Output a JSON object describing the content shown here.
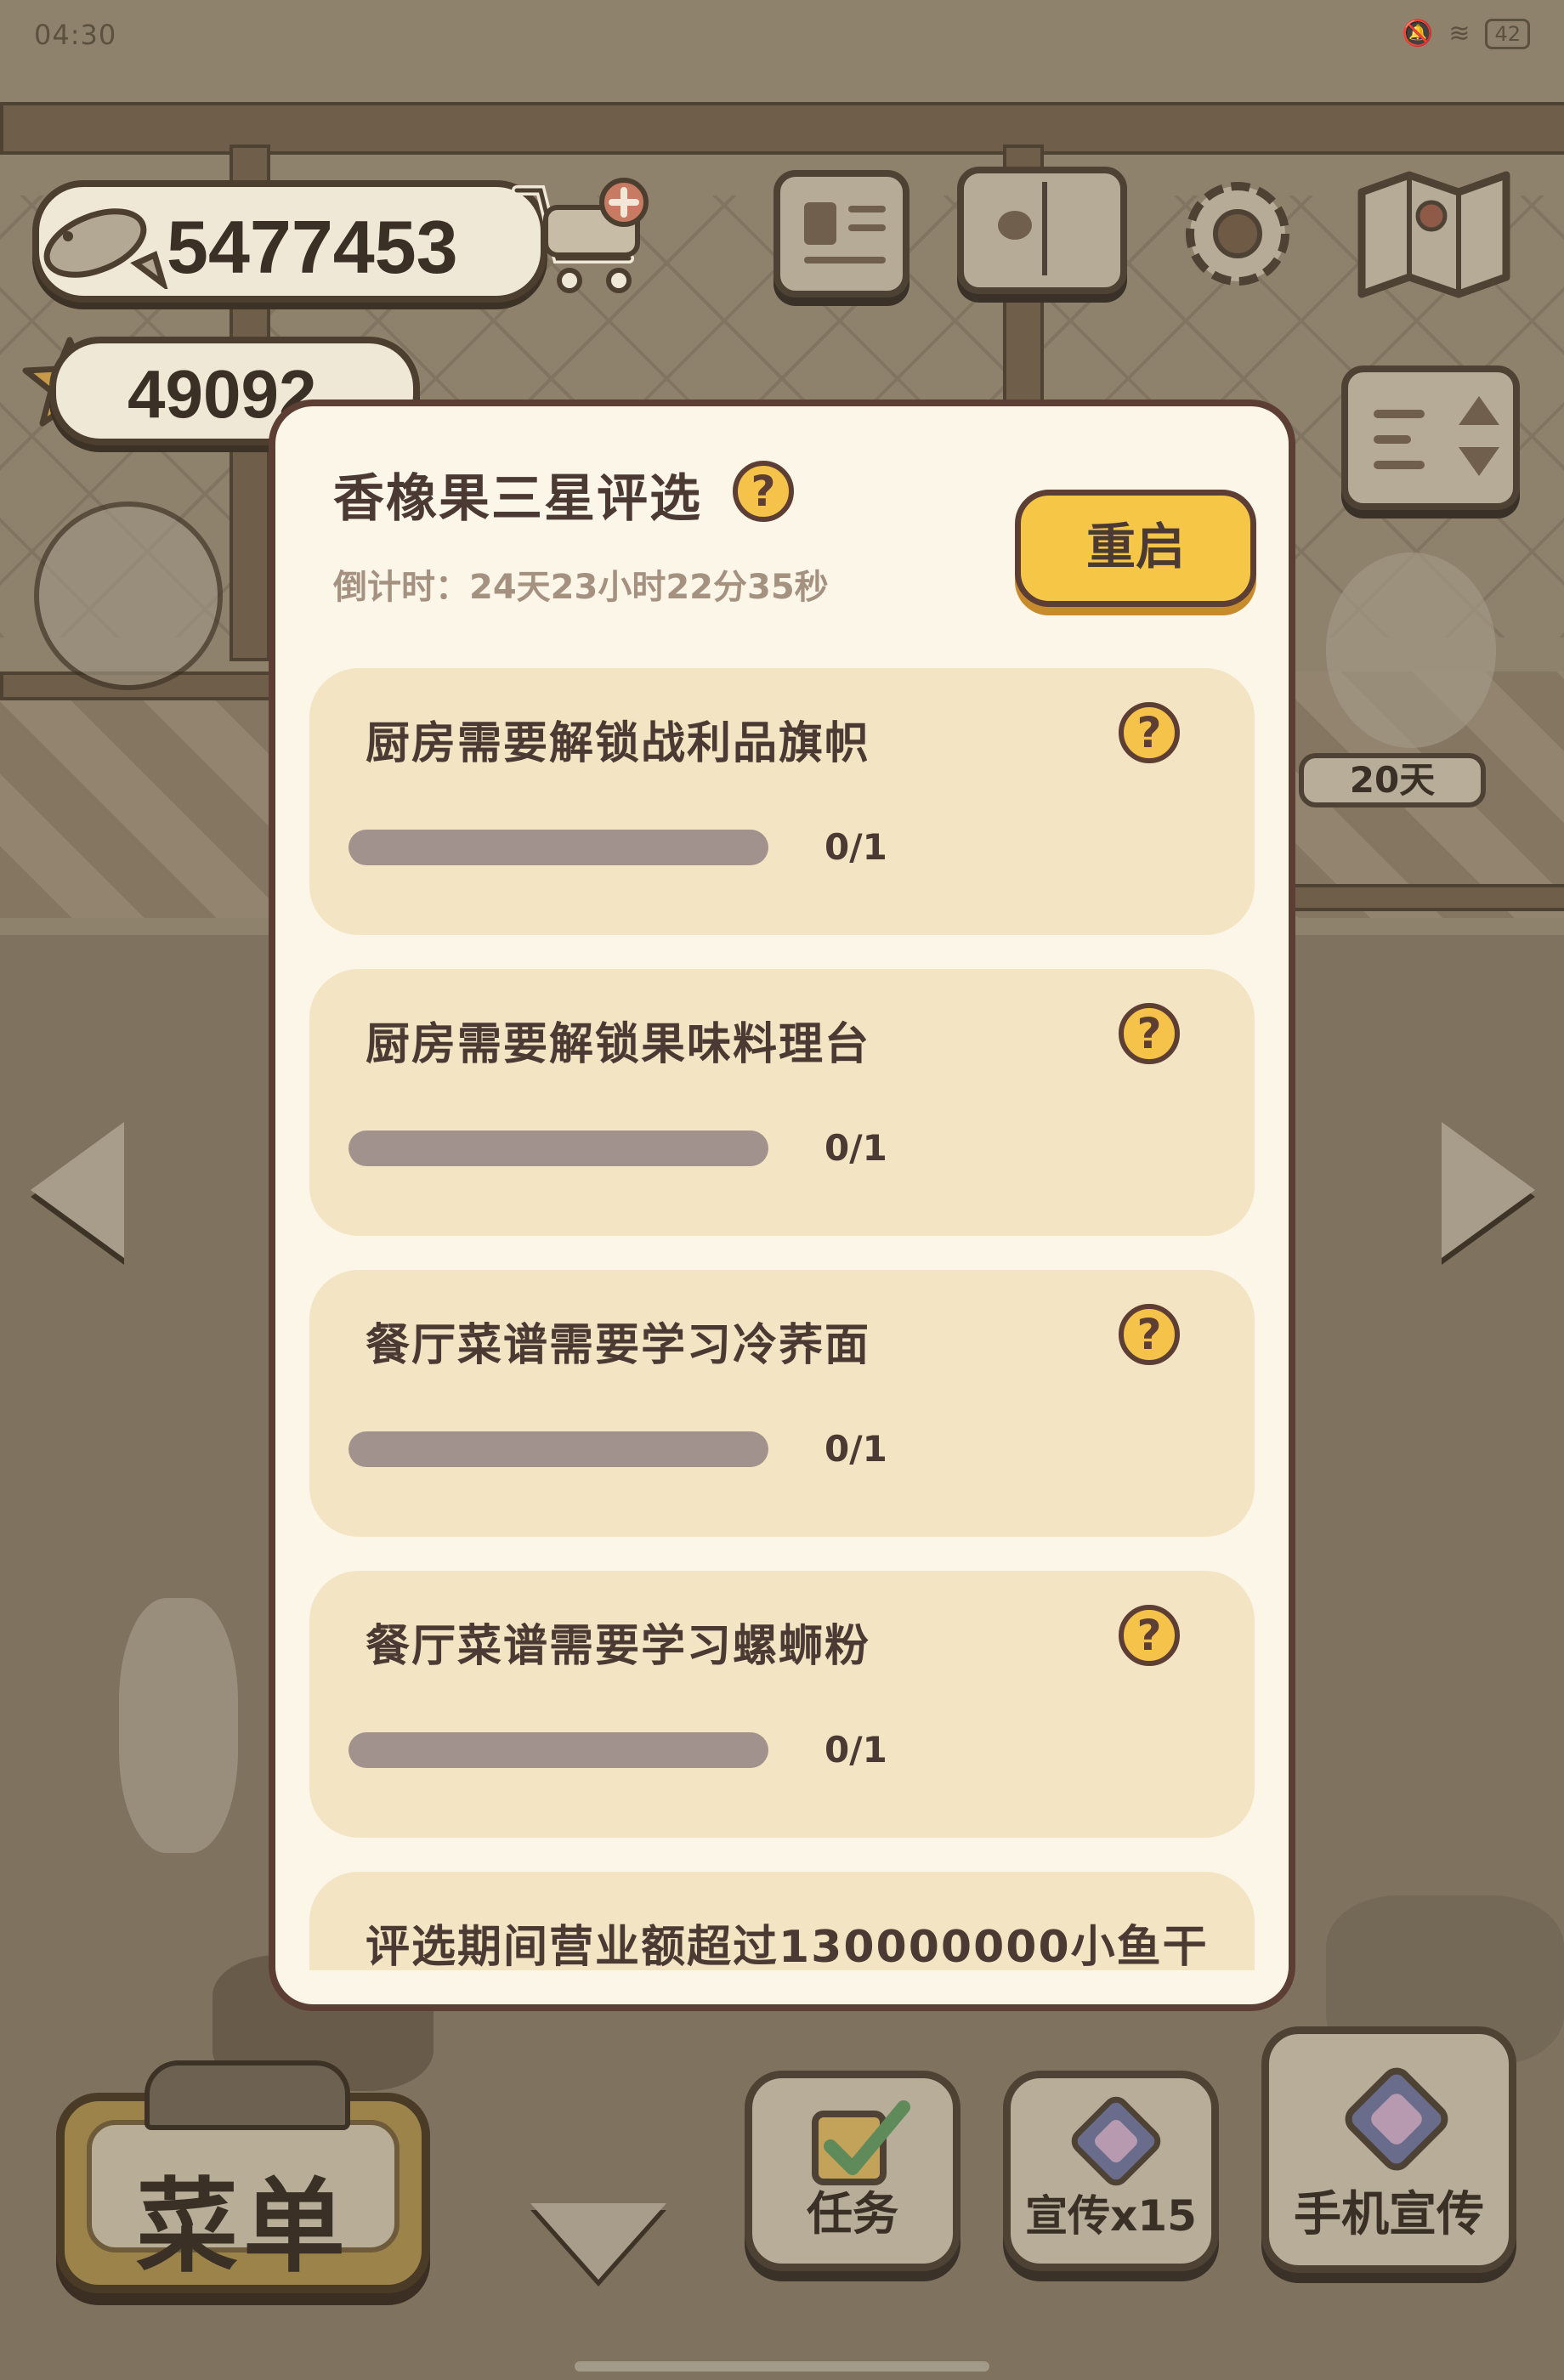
{
  "status_bar": {
    "time": "04:30",
    "battery": "42"
  },
  "currency": {
    "fish": "5477453",
    "stars": "49092"
  },
  "side_badge": {
    "days": "20天"
  },
  "modal": {
    "title": "香橡果三星评选",
    "countdown": "倒计时：24天23小时22分35秒",
    "restart_label": "重启",
    "tasks": [
      {
        "label": "厨房需要解锁战利品旗帜",
        "progress_text": "0/1",
        "progress": 0
      },
      {
        "label": "厨房需要解锁果味料理台",
        "progress_text": "0/1",
        "progress": 0
      },
      {
        "label": "餐厅菜谱需要学习冷荞面",
        "progress_text": "0/1",
        "progress": 0
      },
      {
        "label": "餐厅菜谱需要学习螺蛳粉",
        "progress_text": "0/1",
        "progress": 0
      },
      {
        "label": "评选期间营业额超过130000000小鱼干"
      }
    ]
  },
  "bottom_bar": {
    "menu_label": "菜单",
    "task_label": "任务",
    "promo_label": "宣传x15",
    "phone_promo_label": "手机宣传"
  },
  "colors": {
    "accent": "#f6c747",
    "panel": "#fcf6e9",
    "task_bg": "#f3e5c3",
    "outline": "#5c3e34",
    "bar_empty": "#a2928e"
  },
  "icons": [
    "fish-icon",
    "cart-plus-icon",
    "star-icon",
    "profile-card-icon",
    "paw-book-icon",
    "gear-icon",
    "map-icon",
    "sort-toggle-icon",
    "help-icon",
    "checkbox-icon",
    "phone-promo-icon"
  ]
}
